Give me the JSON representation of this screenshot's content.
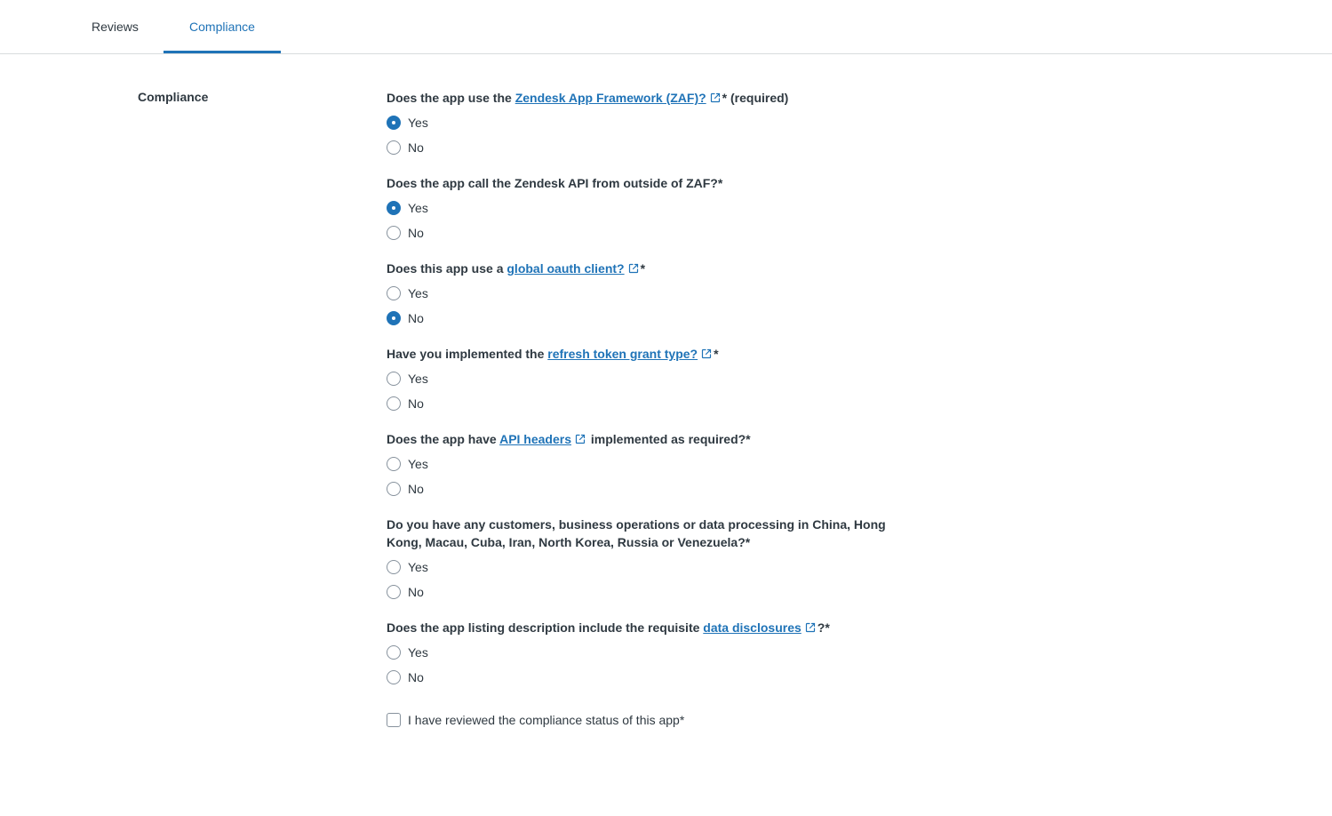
{
  "tabs": {
    "reviews": "Reviews",
    "compliance": "Compliance"
  },
  "section_label": "Compliance",
  "questions": [
    {
      "before": "Does the app use the ",
      "link": "Zendesk App Framework (ZAF)?",
      "after": "* (required)",
      "options": [
        "Yes",
        "No"
      ],
      "selected": "Yes"
    },
    {
      "before": "Does the app call the Zendesk API from outside of ZAF?*",
      "link": "",
      "after": "",
      "options": [
        "Yes",
        "No"
      ],
      "selected": "Yes"
    },
    {
      "before": "Does this app use a ",
      "link": "global oauth client?",
      "after": "*",
      "options": [
        "Yes",
        "No"
      ],
      "selected": "No"
    },
    {
      "before": "Have you implemented the ",
      "link": "refresh token grant type?",
      "after": "*",
      "options": [
        "Yes",
        "No"
      ],
      "selected": ""
    },
    {
      "before": "Does the app have ",
      "link": "API headers",
      "after": " implemented as required?*",
      "options": [
        "Yes",
        "No"
      ],
      "selected": ""
    },
    {
      "before": "Do you have any customers, business operations or data processing in China, Hong Kong, Macau, Cuba, Iran, North Korea, Russia or Venezuela?*",
      "link": "",
      "after": "",
      "options": [
        "Yes",
        "No"
      ],
      "selected": ""
    },
    {
      "before": "Does the app listing description include the requisite ",
      "link": "data disclosures",
      "after": "?*",
      "options": [
        "Yes",
        "No"
      ],
      "selected": ""
    }
  ],
  "review_checkbox_label": "I have reviewed the compliance status of this app*",
  "review_checked": false,
  "colors": {
    "accent": "#1f73b7",
    "text": "#2f3941",
    "border": "#87929d"
  },
  "icons": {
    "external_link": "external-link-icon"
  }
}
